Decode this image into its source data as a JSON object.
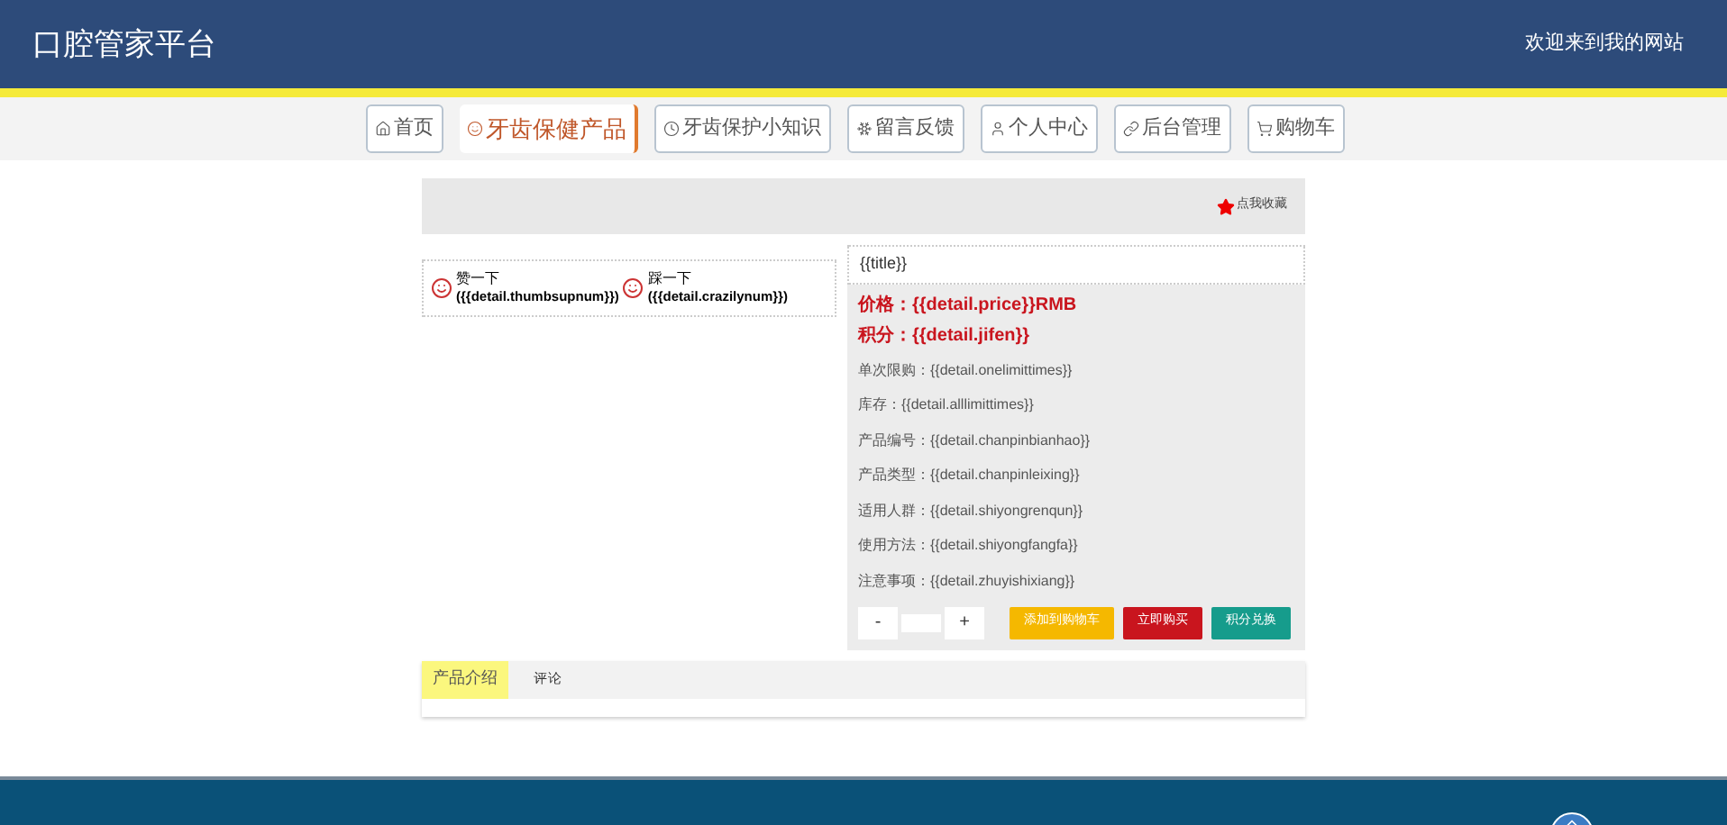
{
  "header": {
    "title": "口腔管家平台",
    "welcome": "欢迎来到我的网站"
  },
  "nav": [
    {
      "label": "首页",
      "selected": false
    },
    {
      "label": "牙齿保健产品",
      "selected": true
    },
    {
      "label": "牙齿保护小知识",
      "selected": false
    },
    {
      "label": "留言反馈",
      "selected": false
    },
    {
      "label": "个人中心",
      "selected": false
    },
    {
      "label": "后台管理",
      "selected": false
    },
    {
      "label": "购物车",
      "selected": false
    }
  ],
  "favorite": "点我收藏",
  "votes": [
    {
      "label": "赞一下",
      "count": "({{detail.thumbsupnum}})"
    },
    {
      "label": "踩一下",
      "count": "({{detail.crazilynum}})"
    }
  ],
  "title": "{{title}}",
  "price": "价格：{{detail.price}}RMB",
  "points": "积分：{{detail.jifen}}",
  "details": [
    "单次限购：{{detail.onelimittimes}}",
    "库存：{{detail.alllimittimes}}",
    "产品编号：{{detail.chanpinbianhao}}",
    "产品类型：{{detail.chanpinleixing}}",
    "适用人群：{{detail.shiyongrenqun}}",
    "使用方法：{{detail.shiyongfangfa}}",
    "注意事项：{{detail.zhuyishixiang}}"
  ],
  "quantity": {
    "minus": "-",
    "plus": "+"
  },
  "actions": [
    {
      "label": "添加到购物车",
      "color": "#f5b800"
    },
    {
      "label": "立即购买",
      "color": "#c9151e"
    },
    {
      "label": "积分兑换",
      "color": "#169c8c"
    }
  ],
  "tabs": [
    {
      "label": "产品介绍",
      "selected": true
    },
    {
      "label": "评论",
      "selected": false
    }
  ]
}
